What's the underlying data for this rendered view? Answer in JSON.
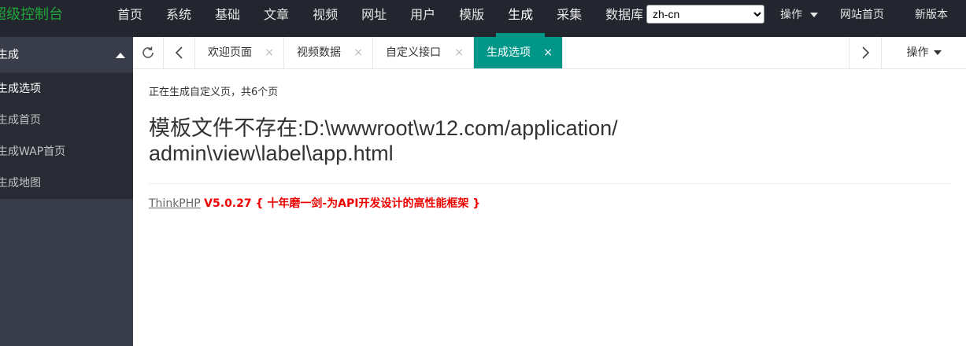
{
  "header": {
    "logo": "超级控制台",
    "nav": [
      "首页",
      "系统",
      "基础",
      "文章",
      "视频",
      "网址",
      "用户",
      "模版",
      "生成",
      "采集",
      "数据库"
    ],
    "active_nav": 8,
    "language": "zh-cn",
    "ops_label": "操作",
    "site_home": "网站首页",
    "new_version": "新版本"
  },
  "sidebar": {
    "group_title": "生成",
    "items": [
      "生成选项",
      "生成首页",
      "生成WAP首页",
      "生成地图"
    ],
    "active_item": 0
  },
  "tabs": {
    "items": [
      "欢迎页面",
      "视频数据",
      "自定义接口",
      "生成选项"
    ],
    "active_tab": 3,
    "close_glyph": "×",
    "ops_label": "操作"
  },
  "content": {
    "message": "正在生成自定义页，共6个页",
    "error_line1": "模板文件不存在:D:\\wwwroot\\w12.com/application/",
    "error_line2": "admin\\view\\label\\app.html",
    "framework_name": "ThinkPHP",
    "framework_version": "V5.0.27 { 十年磨一剑-为API开发设计的高性能框架 }"
  },
  "colors": {
    "accent": "#009688",
    "logo": "#20a53a",
    "header_bg": "#23262e",
    "sidebar_bg": "#393d49",
    "error_red": "#e00000"
  }
}
